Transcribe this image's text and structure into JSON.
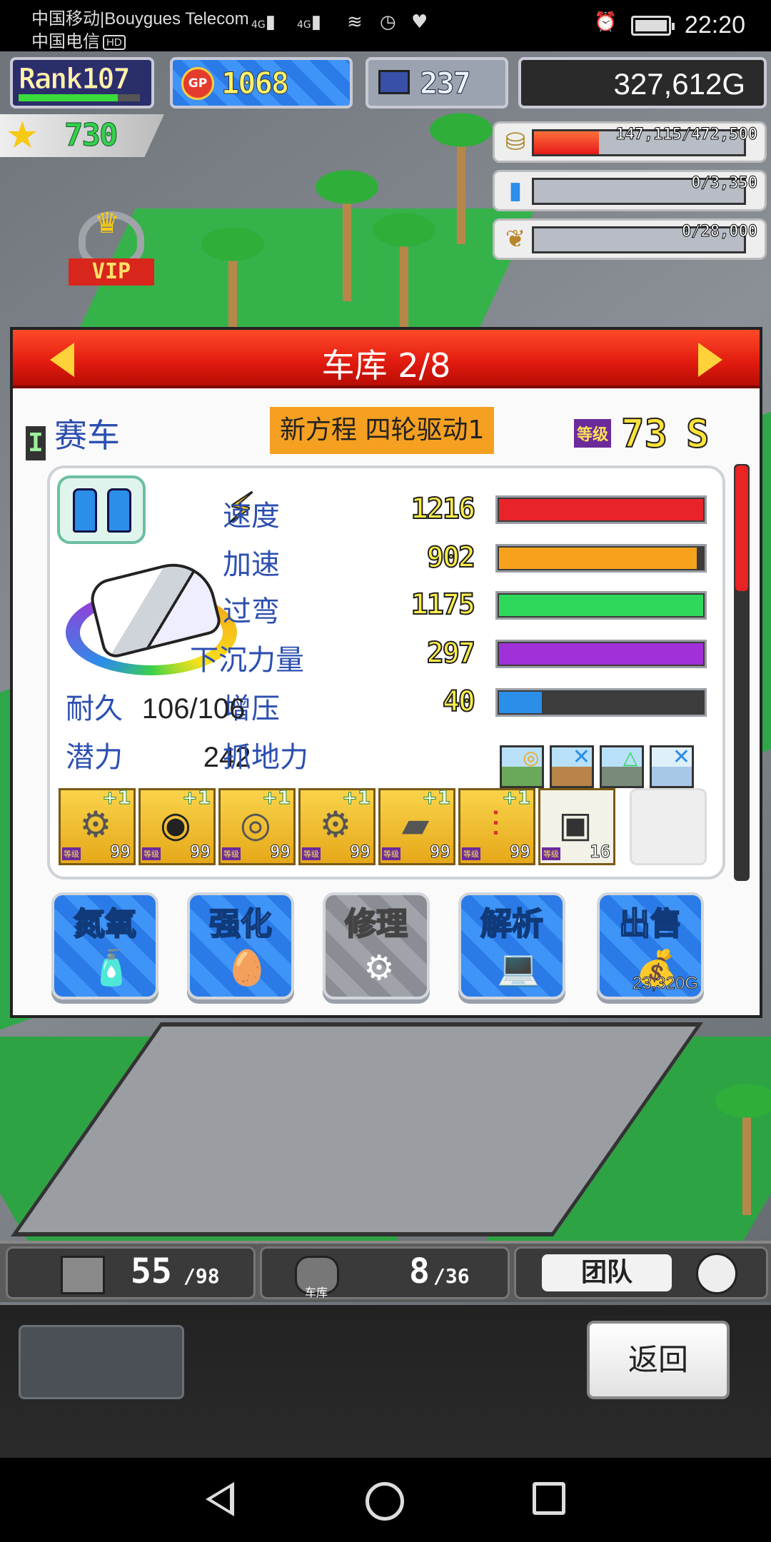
{
  "status_bar": {
    "carrier1": "中国移动|Bouygues Telecom",
    "carrier2": "中国电信",
    "hd": "HD",
    "signal1": "4G",
    "signal2": "4G",
    "time": "22:20"
  },
  "top": {
    "rank_label": "Rank107",
    "rank_progress": 0.82,
    "gp_label": "GP",
    "gp_value": "1068",
    "research_value": "237",
    "money": "327,612G",
    "stars": "730"
  },
  "resources": [
    {
      "icon": "coin-stack-icon",
      "value": "147,115/472,500",
      "fill": 0.31
    },
    {
      "icon": "fuel-bottle-icon",
      "value": "0/3,350",
      "fill": 0
    },
    {
      "icon": "wheat-icon",
      "value": "0/28,000",
      "fill": 0
    }
  ],
  "vip_label": "VIP",
  "panel": {
    "title": "车库 2/8",
    "category_tag": "I",
    "category": "赛车",
    "car_name": "新方程 四轮驱动1",
    "level_label": "等级",
    "level": "73",
    "grade": "S",
    "stats": [
      {
        "name": "速度",
        "value": "1216",
        "fill": 1.0,
        "color": "#e8242a"
      },
      {
        "name": "加速",
        "value": "902",
        "fill": 0.97,
        "color": "#f6a21c"
      },
      {
        "name": "过弯",
        "value": "1175",
        "fill": 1.0,
        "color": "#2fd85a"
      },
      {
        "name": "下沉力量",
        "value": "297",
        "fill": 1.0,
        "color": "#a030d8"
      },
      {
        "name": "增压",
        "value": "40",
        "fill": 0.22,
        "color": "#2b8ee8"
      }
    ],
    "durability_label": "耐久",
    "durability_value": "106/106",
    "potential_label": "潜力",
    "potential_value": "242",
    "grip_label": "抓地力",
    "parts": [
      {
        "name": "engine-icon",
        "glyph": "⚙",
        "plus": "+1",
        "level": "99",
        "lv_tag": "等级"
      },
      {
        "name": "tire-icon",
        "glyph": "◉",
        "plus": "+1",
        "level": "99",
        "lv_tag": "等级"
      },
      {
        "name": "brake-icon",
        "glyph": "◎",
        "plus": "+1",
        "level": "99",
        "lv_tag": "等级"
      },
      {
        "name": "turbo-icon",
        "glyph": "⚙",
        "plus": "+1",
        "level": "99",
        "lv_tag": "等级"
      },
      {
        "name": "wing-icon",
        "glyph": "▰",
        "plus": "+1",
        "level": "99",
        "lv_tag": "等级"
      },
      {
        "name": "suspension-icon",
        "glyph": "⫶",
        "plus": "+1",
        "level": "99",
        "lv_tag": "等级"
      },
      {
        "name": "chip-icon",
        "glyph": "▣",
        "plus": "",
        "level": "16",
        "lv_tag": "等级"
      }
    ],
    "buttons": [
      {
        "label": "氮氧",
        "icon": "nitro-bottle-icon",
        "glyph": "🧴",
        "price": ""
      },
      {
        "label": "强化",
        "icon": "golden-egg-icon",
        "glyph": "🥚",
        "price": ""
      },
      {
        "label": "修理",
        "icon": "wrench-gear-icon",
        "glyph": "⚙",
        "price": ""
      },
      {
        "label": "解析",
        "icon": "analysis-computer-icon",
        "glyph": "💻",
        "price": ""
      },
      {
        "label": "出售",
        "icon": "money-bag-icon",
        "glyph": "💰",
        "price": "23,320G"
      }
    ]
  },
  "strip": {
    "items_count": "55",
    "items_max": "/98",
    "garage_label": "车库",
    "garage_count": "8",
    "garage_max": "/36",
    "team_label": "团队"
  },
  "back_label": "返回"
}
